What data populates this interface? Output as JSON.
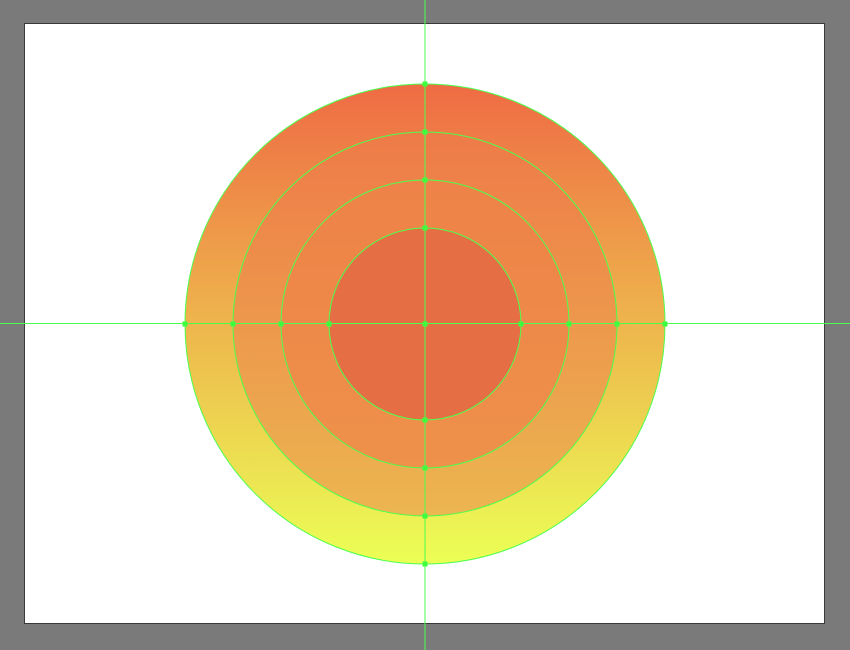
{
  "canvas": {
    "workspace_color": "#7a7a7a",
    "artboard_color": "#ffffff",
    "guide_color": "#4dff4d",
    "anchor_color": "#3dff3d"
  },
  "artwork": {
    "rings": [
      {
        "name": "outer-circle",
        "gradient": [
          "#ef6b44",
          "#ecff55"
        ]
      },
      {
        "name": "second-circle",
        "gradient": [
          "#ee7a48",
          "#ecb650"
        ]
      },
      {
        "name": "third-circle",
        "gradient": [
          "#ee8248",
          "#ee914a"
        ]
      },
      {
        "name": "inner-circle",
        "gradient": [
          "#e66e44",
          "#e66e44"
        ]
      }
    ]
  }
}
